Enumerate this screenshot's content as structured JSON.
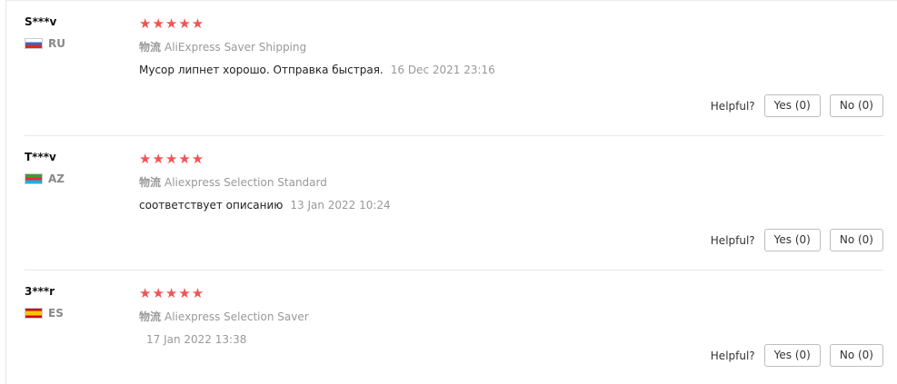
{
  "reviews": [
    {
      "user": "S***v",
      "country": "RU",
      "stars": "★★★★★",
      "shipping_label": "物流",
      "shipping": "AliExpress Saver Shipping",
      "comment": "Мусор липнет хорошо. Отправка быстрая.",
      "date": "16 Dec 2021 23:16",
      "helpful_label": "Helpful?",
      "yes_label": "Yes (0)",
      "no_label": "No (0)"
    },
    {
      "user": "T***v",
      "country": "AZ",
      "stars": "★★★★★",
      "shipping_label": "物流",
      "shipping": "Aliexpress Selection Standard",
      "comment": "соответствует описанию",
      "date": "13 Jan 2022 10:24",
      "helpful_label": "Helpful?",
      "yes_label": "Yes (0)",
      "no_label": "No (0)"
    },
    {
      "user": "3***r",
      "country": "ES",
      "stars": "★★★★★",
      "shipping_label": "物流",
      "shipping": "Aliexpress Selection Saver",
      "comment": "",
      "date": "17 Jan 2022 13:38",
      "helpful_label": "Helpful?",
      "yes_label": "Yes (0)",
      "no_label": "No (0)"
    }
  ],
  "colors": {
    "star": "#f05454",
    "muted": "#999999",
    "border": "#bdbdbd"
  },
  "ratings": [
    5,
    5,
    5
  ]
}
